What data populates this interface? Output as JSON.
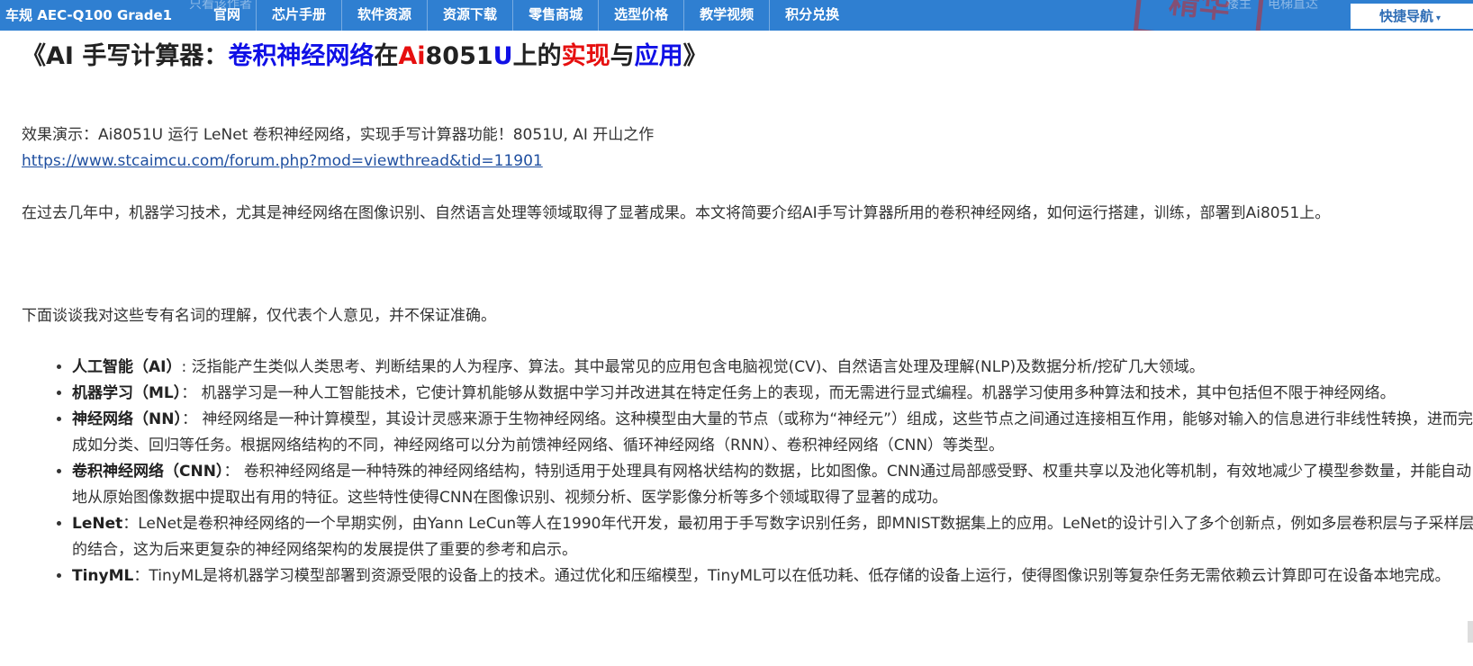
{
  "header": {
    "brand": "车规 AEC-Q100 Grade1",
    "ghost_left": "只看该作者",
    "ghost_right_1": "楼主",
    "ghost_right_2": "电梯直达",
    "stamp": "精华",
    "nav": [
      "官网",
      "芯片手册",
      "软件资源",
      "资源下载",
      "零售商城",
      "选型价格",
      "教学视频",
      "积分兑换"
    ],
    "quick_nav": "快捷导航",
    "quick_nav_caret": "▾"
  },
  "article": {
    "title": {
      "open": "《",
      "part1": "AI 手写计算器：",
      "part2": "卷积神经网络",
      "part3": "在",
      "part4": "Ai",
      "part5": "8051",
      "part6": "U",
      "part7": "上的",
      "part8": "实现",
      "part9": "与",
      "part10": "应用",
      "close": "》"
    },
    "demo_text": "效果演示：Ai8051U 运行 LeNet 卷积神经网络，实现手写计算器功能！8051U, AI 开山之作",
    "demo_link": "https://www.stcaimcu.com/forum.php?mod=viewthread&tid=11901",
    "intro": "在过去几年中，机器学习技术，尤其是神经网络在图像识别、自然语言处理等领域取得了显著成果。本文将简要介绍AI手写计算器所用的卷积神经网络，如何运行搭建，训练，部署到Ai8051上。",
    "lead": "下面谈谈我对这些专有名词的理解，仅代表个人意见，并不保证准确。",
    "terms": [
      {
        "term": "人工智能（AI）",
        "desc": ": 泛指能产生类似人类思考、判断结果的人为程序、算法。其中最常见的应用包含电脑视觉(CV)、自然语言处理及理解(NLP)及数据分析/挖矿几大领域。"
      },
      {
        "term": "机器学习（ML）",
        "desc": "： 机器学习是一种人工智能技术，它使计算机能够从数据中学习并改进其在特定任务上的表现，而无需进行显式编程。机器学习使用多种算法和技术，其中包括但不限于神经网络。"
      },
      {
        "term": "神经网络（NN）",
        "desc": "： 神经网络是一种计算模型，其设计灵感来源于生物神经网络。这种模型由大量的节点（或称为“神经元”）组成，这些节点之间通过连接相互作用，能够对输入的信息进行非线性转换，进而完成如分类、回归等任务。根据网络结构的不同，神经网络可以分为前馈神经网络、循环神经网络（RNN）、卷积神经网络（CNN）等类型。"
      },
      {
        "term": "卷积神经网络（CNN）",
        "desc": "： 卷积神经网络是一种特殊的神经网络结构，特别适用于处理具有网格状结构的数据，比如图像。CNN通过局部感受野、权重共享以及池化等机制，有效地减少了模型参数量，并能自动地从原始图像数据中提取出有用的特征。这些特性使得CNN在图像识别、视频分析、医学影像分析等多个领域取得了显著的成功。"
      },
      {
        "term": "LeNet",
        "desc": "：LeNet是卷积神经网络的一个早期实例，由Yann LeCun等人在1990年代开发，最初用于手写数字识别任务，即MNIST数据集上的应用。LeNet的设计引入了多个创新点，例如多层卷积层与子采样层的结合，这为后来更复杂的神经网络架构的发展提供了重要的参考和启示。"
      },
      {
        "term": "TinyML",
        "desc": "：TinyML是将机器学习模型部署到资源受限的设备上的技术。通过优化和压缩模型，TinyML可以在低功耗、低存储的设备上运行，使得图像识别等复杂任务无需依赖云计算即可在设备本地完成。"
      }
    ]
  }
}
